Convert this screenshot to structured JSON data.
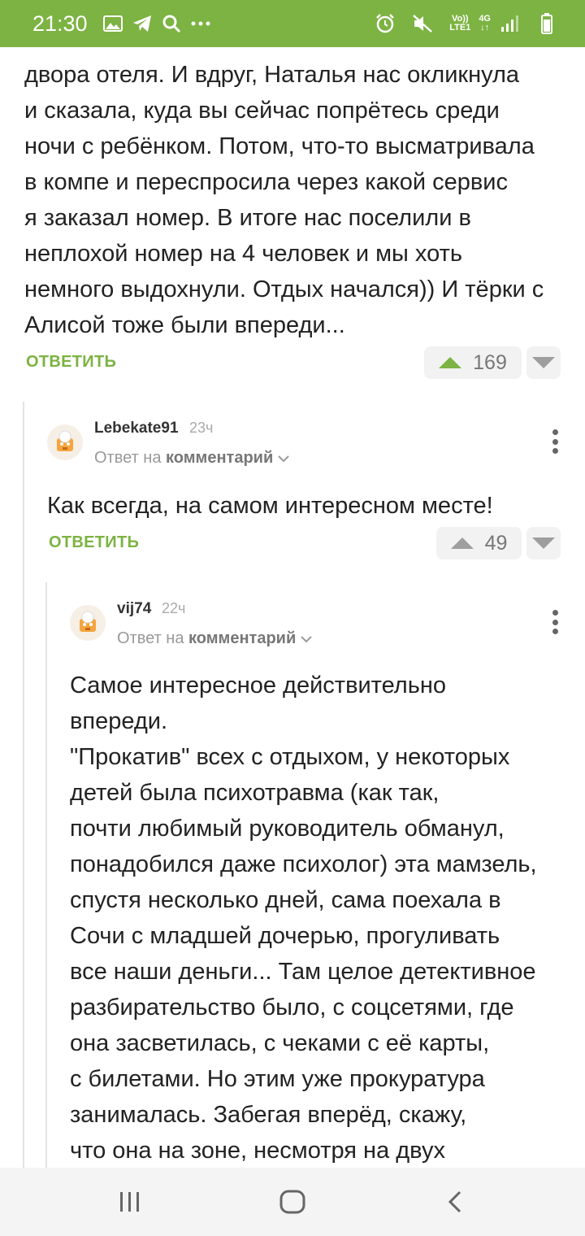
{
  "status_bar": {
    "time": "21:30",
    "network_top": "Vo))",
    "network_bottom": "LTE1",
    "net_type": "4G"
  },
  "top_comment": {
    "text": "двора отеля. И вдруг, Наталья нас окликнула\nи сказала, куда вы сейчас попрётесь среди\nночи с ребёнком. Потом, что-то высматривала\nв компе и переспросила через какой сервис\nя заказал номер. В итоге нас поселили в\nнеплохой номер на 4 человек и мы хоть\nнемного выдохнули. Отдых начался)) И тёрки с\nАлисой тоже были впереди...",
    "reply_label": "ОТВЕТИТЬ",
    "votes": "169"
  },
  "comment_1": {
    "username": "Lebekate91",
    "time": "23ч",
    "reply_prefix": "Ответ на",
    "reply_target": "комментарий",
    "text": "Как всегда, на самом интересном месте!",
    "reply_label": "ОТВЕТИТЬ",
    "votes": "49"
  },
  "comment_2": {
    "username": "vij74",
    "time": "22ч",
    "reply_prefix": "Ответ на",
    "reply_target": "комментарий",
    "text": "Самое интересное действительно\nвпереди.\n\"Прокатив\" всех с отдыхом, у некоторых\nдетей была психотравма (как так,\nпочти любимый руководитель обманул,\nпонадобился даже психолог) эта мамзель,\nспустя несколько дней, сама поехала в\nСочи с младшей дочерью, прогуливать\nвсе наши деньги... Там целое детективное\nразбирательство было, с соцсетями, где\nона засветилась, с чеками с её карты,\nс билетами. Но этим уже прокуратура\nзанималась. Забегая вперёд, скажу,\nчто она на зоне, несмотря на двух"
  },
  "colors": {
    "accent": "#7cb342",
    "text": "#222222",
    "muted": "#999999"
  }
}
